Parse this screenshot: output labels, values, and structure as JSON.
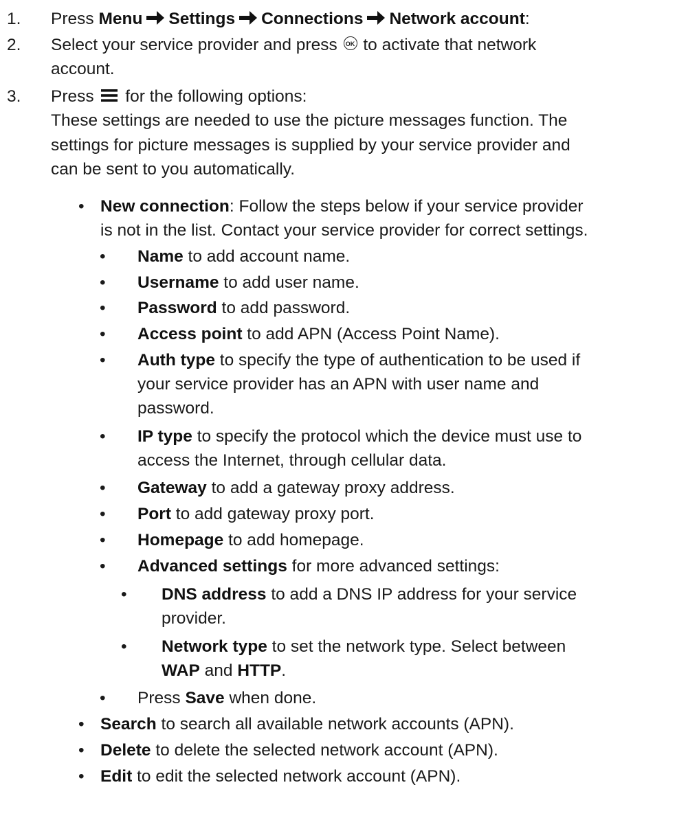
{
  "steps": {
    "s1": {
      "num": "1.",
      "press": "Press",
      "menu": "Menu",
      "settings": "Settings",
      "connections": "Connections",
      "network_account": "Network account",
      "colon": ":"
    },
    "s2": {
      "num": "2.",
      "text_a": "Select your service provider and press",
      "text_b": "to activate that network",
      "text_c": "account."
    },
    "s3": {
      "num": "3.",
      "press": "Press",
      "text_b": "for the following options:",
      "para_1": "These settings are needed to use the picture messages function. The",
      "para_2": "settings for picture messages is supplied by your service provider and",
      "para_3": "can be sent to you automatically."
    }
  },
  "icons": {
    "ok": "OK",
    "arrow": "right-arrow-icon",
    "menu": "menu-icon"
  },
  "options": {
    "new_connection": {
      "bullet": "•",
      "label": "New connection",
      "text_1": ": Follow the steps below if your service provider",
      "text_2": "is not in the list. Contact your service provider for correct settings."
    },
    "sub": [
      {
        "bullet": "•",
        "label": "Name",
        "text": " to add account name."
      },
      {
        "bullet": "•",
        "label": "Username",
        "text": " to add user name."
      },
      {
        "bullet": "•",
        "label": "Password",
        "text": " to add password."
      },
      {
        "bullet": "•",
        "label": "Access point",
        "text": " to add APN (Access Point Name)."
      },
      {
        "bullet": "•",
        "label": "Auth type",
        "text": " to specify the type of authentication to be used if",
        "text_2": "your service provider has an APN with user name and",
        "text_3": "password."
      },
      {
        "bullet": "•",
        "label": "IP type",
        "text": " to specify the protocol which the device must use to",
        "text_2": "access the Internet, through cellular data."
      },
      {
        "bullet": "•",
        "label": "Gateway",
        "text": " to add a gateway proxy address."
      },
      {
        "bullet": "•",
        "label": "Port",
        "text": " to add gateway proxy port."
      },
      {
        "bullet": "•",
        "label": "Homepage",
        "text": " to add homepage."
      },
      {
        "bullet": "•",
        "label": "Advanced settings",
        "text": " for more advanced settings:"
      }
    ],
    "advanced": [
      {
        "bullet": "•",
        "label": "DNS address",
        "text": " to add a DNS IP address for your service",
        "text_2": "provider."
      },
      {
        "bullet": "•",
        "label": "Network type",
        "text": " to set the network type. Select between",
        "wap": "WAP",
        "and": " and ",
        "http": "HTTP",
        "dot": "."
      }
    ],
    "save": {
      "bullet": "•",
      "press": "Press ",
      "label": "Save",
      "text": " when done."
    },
    "top": [
      {
        "bullet": "•",
        "label": "Search",
        "text": " to search all available network accounts (APN)."
      },
      {
        "bullet": "•",
        "label": "Delete",
        "text": " to delete the selected network account (APN)."
      },
      {
        "bullet": "•",
        "label": "Edit",
        "text": " to edit the selected network account (APN)."
      }
    ]
  }
}
